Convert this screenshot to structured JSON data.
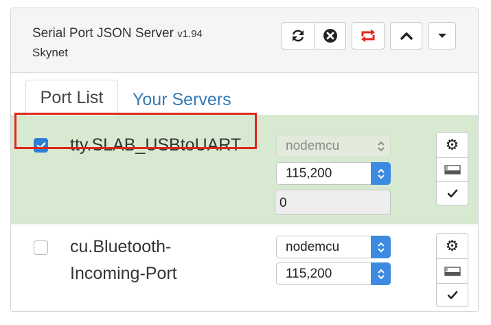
{
  "header": {
    "title": "Serial Port JSON Server",
    "version": "v1.94",
    "subtitle": "Skynet",
    "buttons": [
      "refresh-icon",
      "stop-icon",
      "reconnect-icon",
      "chevron-up-icon",
      "caret-down-icon"
    ]
  },
  "tabs": [
    {
      "label": "Port List",
      "active": true
    },
    {
      "label": "Your Servers",
      "active": false
    }
  ],
  "ports": [
    {
      "name": "tty.SLAB_USBtoUART",
      "checked": true,
      "highlighted": true,
      "board": "nodemcu",
      "board_disabled": true,
      "baud": "115,200",
      "buffer": "0"
    },
    {
      "name_line1": "cu.Bluetooth-",
      "name_line2": "Incoming-Port",
      "checked": false,
      "highlighted": false,
      "board": "nodemcu",
      "board_disabled": false,
      "baud": "115,200"
    }
  ],
  "colors": {
    "selected_row": "#d7ead1",
    "accent": "#3d8be0",
    "link": "#337ab7",
    "highlight": "#e0271c",
    "reconnect": "#e0271c"
  }
}
